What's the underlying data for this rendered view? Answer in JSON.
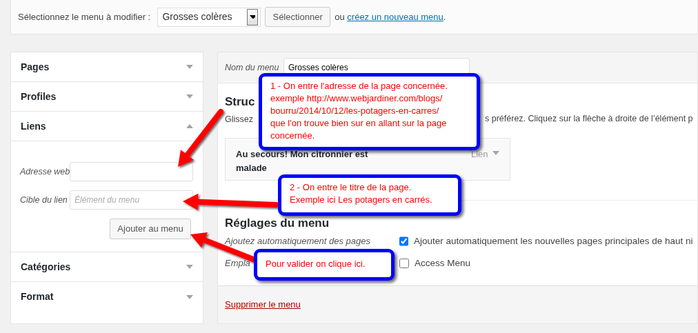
{
  "menu_selector": {
    "label": "Sélectionnez le menu à modifier :",
    "value": "Grosses colères",
    "button": "Sélectionner",
    "text_before_link": "ou",
    "link": "créez un nouveau menu",
    "text_after_link": "."
  },
  "sidebar": {
    "sections": [
      {
        "title": "Pages",
        "expanded": false
      },
      {
        "title": "Profiles",
        "expanded": false
      },
      {
        "title": "Liens",
        "expanded": true,
        "fields": [
          {
            "label": "Adresse web"
          },
          {
            "label": "Cible du lien",
            "placeholder": "Élément du menu"
          }
        ],
        "button": "Ajouter au menu"
      },
      {
        "title": "Catégories",
        "expanded": false
      },
      {
        "title": "Format",
        "expanded": false
      }
    ]
  },
  "menu_editor": {
    "name_label": "Nom du menu",
    "name_value": "Grosses colères",
    "structure_heading": "Struc",
    "structure_hint": [
      "Glissez",
      "s préférez. Cliquez sur la flèche à droite de l’élément p"
    ],
    "items": [
      {
        "title": "Au secours! Mon citronnier est malade",
        "type": "Lien"
      }
    ],
    "settings_heading": "Réglages du menu",
    "settings": [
      {
        "label": "Ajoutez automatiquement des pages",
        "option": "Ajouter automatiquement les nouvelles pages principales de haut ni",
        "checked": true
      },
      {
        "label": "Empla",
        "option": "Access Menu",
        "checked": false
      }
    ],
    "delete_link": "Supprimer le menu"
  },
  "annotations": [
    {
      "lines": [
        "1 - On entre l'adresse de la page concernée.",
        "exemple http://www.webjardiner.com/blogs/",
        "bourru/2014/10/12/les-potagers-en-carres/",
        "que l'on trouve bien sur en allant sur la page",
        "concernée."
      ]
    },
    {
      "lines": [
        "2 - On entre le titre de la page.",
        "Exemple ici Les potagers en carrés."
      ]
    },
    {
      "lines": [
        "Pour valider on clique ici."
      ]
    }
  ]
}
